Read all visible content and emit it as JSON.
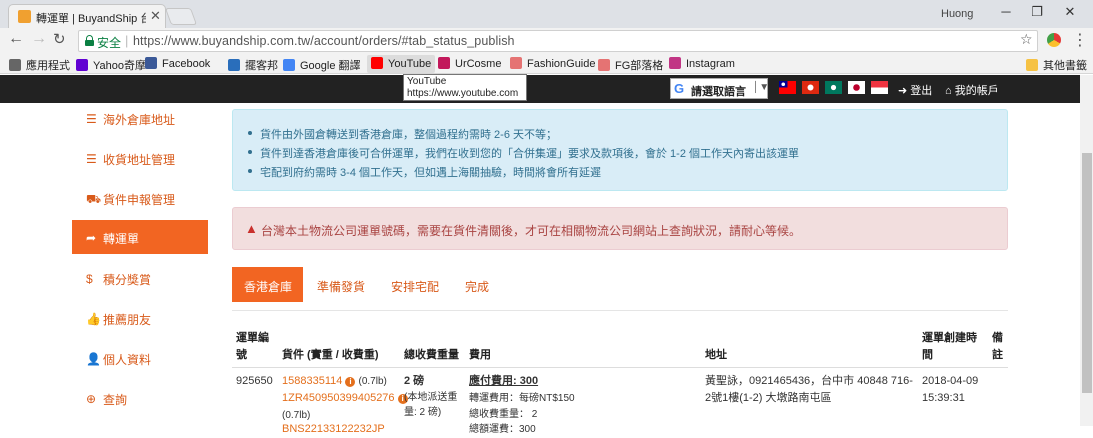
{
  "browser": {
    "tab_title": "轉運單 | BuyandShip 台灣",
    "user_name": "Huong",
    "secure_label": "安全",
    "url": "https://www.buyandship.com.tw/account/orders/#tab_status_publish",
    "bookmarks": [
      {
        "label": "應用程式",
        "icon": "apps-grid-icon",
        "color": "#666666"
      },
      {
        "label": "Yahoo奇摩",
        "icon": "yahoo-icon",
        "color": "#6001d2"
      },
      {
        "label": "Facebook",
        "icon": "facebook-icon",
        "color": "#3b5998"
      },
      {
        "label": "擺客邦",
        "icon": "blog-icon",
        "color": "#2a6ebb"
      },
      {
        "label": "Google 翻譯",
        "icon": "translate-icon",
        "color": "#4285f4"
      },
      {
        "label": "YouTube",
        "icon": "youtube-icon",
        "color": "#ff0000"
      },
      {
        "label": "UrCosme",
        "icon": "urcosme-icon",
        "color": "#c2185b"
      },
      {
        "label": "FashionGuide",
        "icon": "fashionguide-icon",
        "color": "#e57373"
      },
      {
        "label": "FG部落格",
        "icon": "fg-blog-icon",
        "color": "#e57373"
      },
      {
        "label": "Instagram",
        "icon": "instagram-icon",
        "color": "#c13584"
      },
      {
        "label": "其他書籤",
        "icon": "folder-icon",
        "color": "#f6c244"
      }
    ],
    "tooltip": {
      "title": "YouTube",
      "url": "https://www.youtube.com"
    }
  },
  "header": {
    "lang_select": "請選取語言",
    "logout": "登出",
    "my_account": "我的帳戶"
  },
  "sidebar": {
    "items": [
      {
        "label": "海外倉庫地址",
        "icon": "list-icon",
        "active": false
      },
      {
        "label": "收貨地址管理",
        "icon": "list-icon",
        "active": false
      },
      {
        "label": "貨件申報管理",
        "icon": "truck-icon",
        "active": false
      },
      {
        "label": "轉運單",
        "icon": "share-arrow-icon",
        "active": true
      },
      {
        "label": "積分獎賞",
        "icon": "dollar-icon",
        "active": false
      },
      {
        "label": "推薦朋友",
        "icon": "thumbs-up-icon",
        "active": false
      },
      {
        "label": "個人資料",
        "icon": "user-icon",
        "active": false
      },
      {
        "label": "查詢",
        "icon": "lifebuoy-icon",
        "active": false
      }
    ]
  },
  "info_notes": [
    "貨件由外國倉轉送到香港倉庫，整個過程約需時 2-6 天不等；",
    "貨件到達香港倉庫後可合併運單，我們在收到您的「合併集運」要求及款項後，會於 1-2 個工作天內寄出該運單",
    "宅配到府約需時 3-4 個工作天，但如遇上海關抽驗，時間將會所有延遲"
  ],
  "warning": "台灣本土物流公司運單號碼，需要在貨件清關後，才可在相關物流公司網站上查詢狀況，請耐心等候。",
  "status_tabs": [
    "香港倉庫",
    "準備發貨",
    "安排宅配",
    "完成"
  ],
  "table": {
    "headers": {
      "order_no": [
        "運單編",
        "號"
      ],
      "items": "貨件 (實重 / 收費重)",
      "total_weight": "總收費重量",
      "fee": "費用",
      "address": "地址",
      "created": [
        "運單創建時",
        "間"
      ],
      "remark": [
        "備",
        "註"
      ]
    },
    "row": {
      "order_no": "925650",
      "item1_code": "1588335114",
      "item1_weight": "(0.7lb)",
      "item2_code": "1ZR450950399405276",
      "item2_weight": "(0.7lb)",
      "item3_code": "BNS22133122232JP",
      "total_weight": "2 磅",
      "total_weight_note": [
        "(本地派送重",
        "量: 2 磅)"
      ],
      "fee_label": "應付費用: 300",
      "fee_detail1": "轉運費用：每磅NT$150",
      "fee_detail2": "總收費重量：  2",
      "fee_detail3": "總額運費：300",
      "address": [
        "黃聖詠，0921465436，台中市 40848 716-",
        "2號1樓(1-2) 大墩路南屯區"
      ],
      "created": [
        "2018-04-09",
        "15:39:31"
      ]
    }
  }
}
